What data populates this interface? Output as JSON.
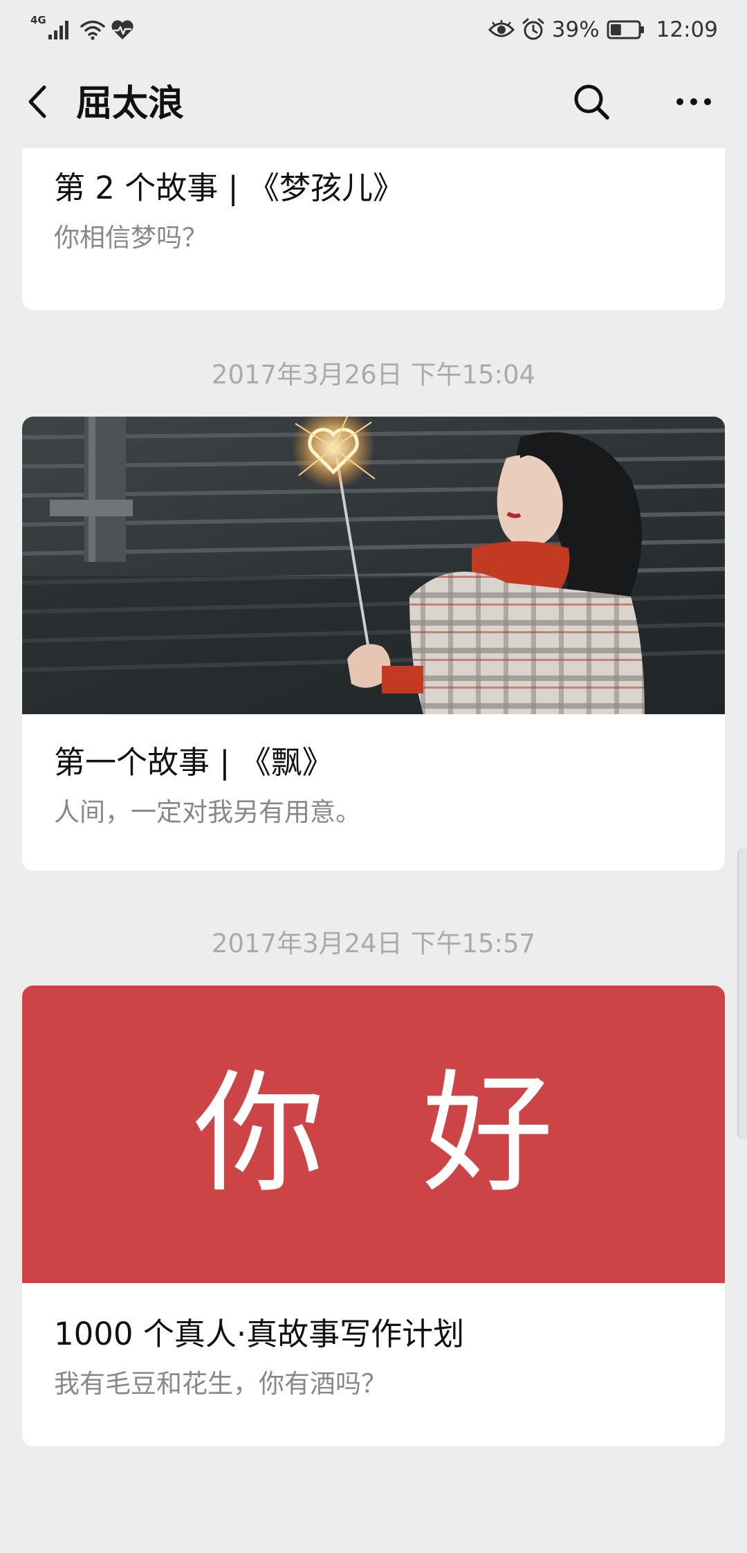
{
  "status_bar": {
    "network": "4G",
    "battery_percent": "39%",
    "time": "12:09",
    "battery_level": 0.39,
    "icons": [
      "signal-icon",
      "wifi-icon",
      "health-icon",
      "eye-icon",
      "alarm-icon",
      "battery-icon"
    ]
  },
  "nav": {
    "title": "屈太浪",
    "back_icon": "chevron-left-icon",
    "search_icon": "search-icon",
    "more_icon": "more-icon"
  },
  "articles": [
    {
      "title": "第 2 个故事 | 《梦孩儿》",
      "desc": "你相信梦吗？"
    },
    {
      "timestamp": "2017年3月26日 下午15:04",
      "title": "第一个故事 | 《飘》",
      "desc": "人间，一定对我另有用意。",
      "cover": "photo"
    },
    {
      "timestamp": "2017年3月24日 下午15:57",
      "cover_text": "你 好",
      "title": "1000 个真人·真故事写作计划",
      "desc": "我有毛豆和花生，你有酒吗？",
      "cover": "red"
    }
  ],
  "colors": {
    "background": "#ededed",
    "card": "#ffffff",
    "cover_red": "#cd4446",
    "text_primary": "#111111",
    "text_secondary": "#888888",
    "timestamp": "#aaaaaa"
  }
}
